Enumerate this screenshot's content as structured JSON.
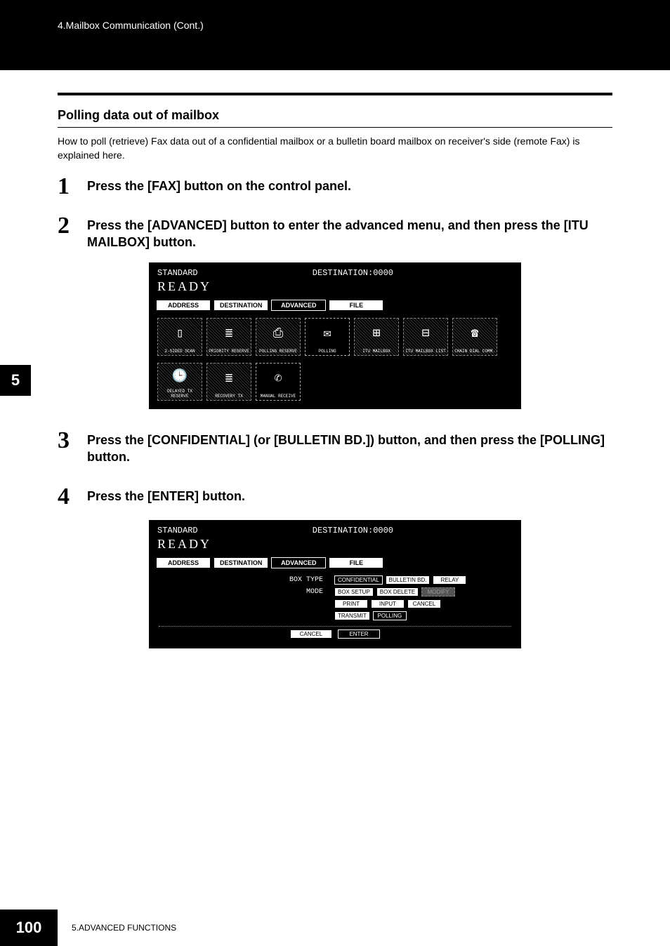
{
  "header": {
    "breadcrumb": "4.Mailbox Communication (Cont.)"
  },
  "section": {
    "title": "Polling data out of mailbox",
    "intro": "How to poll (retrieve) Fax data out of a confidential mailbox or a bulletin board mailbox on receiver's side (remote Fax) is explained here."
  },
  "steps": [
    {
      "num": "1",
      "text": "Press the [FAX] button on the control panel."
    },
    {
      "num": "2",
      "text": "Press the [ADVANCED] button to enter the advanced menu, and then press the [ITU MAILBOX] button."
    },
    {
      "num": "3",
      "text": "Press the [CONFIDENTIAL] (or [BULLETIN BD.]) button, and then press the [POLLING] button."
    },
    {
      "num": "4",
      "text": "Press the [ENTER] button."
    }
  ],
  "screenshot1": {
    "status_left": "STANDARD",
    "status_right": "DESTINATION:0000",
    "ready": "READY",
    "tabs": [
      "ADDRESS",
      "DESTINATION",
      "ADVANCED",
      "FILE"
    ],
    "active_tab": "ADVANCED",
    "icons_row1": [
      {
        "label": "2-SIDED SCAN",
        "glyph": "▯"
      },
      {
        "label": "PRIORITY RESERVE",
        "glyph": "≣"
      },
      {
        "label": "POLLING RESERVE",
        "glyph": "⎙"
      },
      {
        "label": "POLLING",
        "glyph": "✉"
      },
      {
        "label": "ITU MAILBOX",
        "glyph": "⊞"
      },
      {
        "label": "ITU MAILBOX LIST",
        "glyph": "⊟"
      },
      {
        "label": "CHAIN DIAL COMM.",
        "glyph": "☎"
      }
    ],
    "icons_row2": [
      {
        "label": "DELAYED TX RESERVE",
        "glyph": "🕒"
      },
      {
        "label": "RECOVERY TX",
        "glyph": "≣"
      },
      {
        "label": "MANUAL RECEIVE",
        "glyph": "✆"
      }
    ]
  },
  "screenshot2": {
    "status_left": "STANDARD",
    "status_right": "DESTINATION:0000",
    "ready": "READY",
    "tabs": [
      "ADDRESS",
      "DESTINATION",
      "ADVANCED",
      "FILE"
    ],
    "active_tab": "ADVANCED",
    "box_type_label": "BOX TYPE",
    "mode_label": "MODE",
    "box_type_buttons": [
      {
        "label": "CONFIDENTIAL",
        "state": "sel"
      },
      {
        "label": "BULLETIN BD.",
        "state": ""
      },
      {
        "label": "RELAY",
        "state": ""
      }
    ],
    "mode_buttons_r1": [
      {
        "label": "BOX SETUP",
        "state": ""
      },
      {
        "label": "BOX DELETE",
        "state": ""
      },
      {
        "label": "MODIFY",
        "state": "dis"
      }
    ],
    "mode_buttons_r2": [
      {
        "label": "PRINT",
        "state": ""
      },
      {
        "label": "INPUT",
        "state": ""
      },
      {
        "label": "CANCEL",
        "state": ""
      }
    ],
    "mode_buttons_r3": [
      {
        "label": "TRANSMIT",
        "state": ""
      },
      {
        "label": "POLLING",
        "state": "sel"
      }
    ],
    "footer_buttons": [
      {
        "label": "CANCEL",
        "state": ""
      },
      {
        "label": "ENTER",
        "state": "sel"
      }
    ]
  },
  "sidetab": "5",
  "footer": {
    "page": "100",
    "chapter": "5.ADVANCED FUNCTIONS"
  }
}
